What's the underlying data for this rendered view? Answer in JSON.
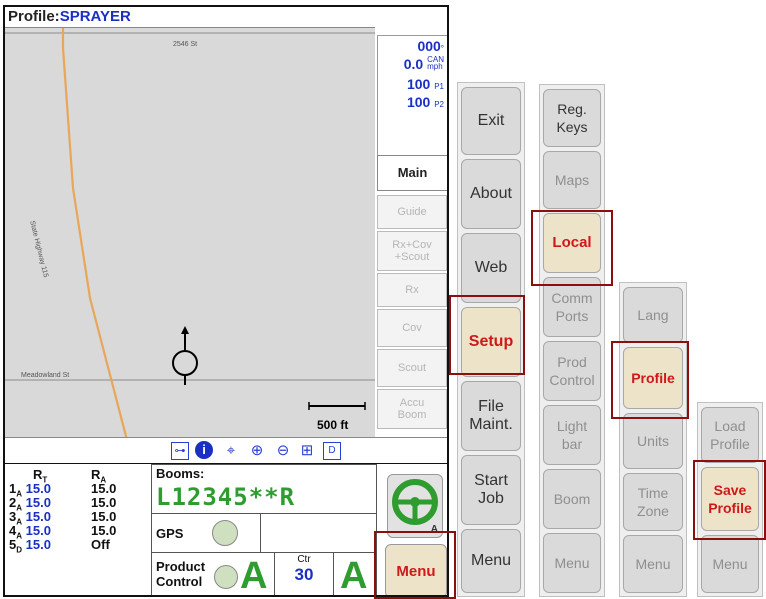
{
  "header": {
    "profile_label": "Profile:",
    "profile_name": "SPRAYER"
  },
  "map": {
    "road_top": "2546 St",
    "road_side": "State Highway 115",
    "road_bottom": "Meadowland St",
    "scale": "500 ft"
  },
  "status": {
    "heading": {
      "value": "000",
      "unit": "°"
    },
    "speed": {
      "value": "0.0",
      "unit_top": "CAN",
      "unit_bottom": "mph"
    },
    "p1": {
      "value": "100",
      "unit": "P1"
    },
    "p2": {
      "value": "100",
      "unit": "P2"
    }
  },
  "tabs": [
    {
      "label": "Main",
      "active": true
    },
    {
      "label": "Guide"
    },
    {
      "label": "Rx+Cov\n+Scout"
    },
    {
      "label": "Rx"
    },
    {
      "label": "Cov"
    },
    {
      "label": "Scout"
    },
    {
      "label": "Accu\nBoom"
    }
  ],
  "rates": {
    "rt_header": "R",
    "rt_sub": "T",
    "ra_header": "R",
    "ra_sub": "A",
    "rows": [
      {
        "idx": "1",
        "sub": "A",
        "rt": "15.0",
        "ra": "15.0"
      },
      {
        "idx": "2",
        "sub": "A",
        "rt": "15.0",
        "ra": "15.0"
      },
      {
        "idx": "3",
        "sub": "A",
        "rt": "15.0",
        "ra": "15.0"
      },
      {
        "idx": "4",
        "sub": "A",
        "rt": "15.0",
        "ra": "15.0"
      },
      {
        "idx": "5",
        "sub": "D",
        "rt": "15.0",
        "ra": "Off"
      }
    ]
  },
  "booms": {
    "label": "Booms:",
    "value": "L12345**R"
  },
  "gps": {
    "label": "GPS"
  },
  "product_control": {
    "label_line1": "Product",
    "label_line2": "Control",
    "mode1": "A",
    "ctr_label": "Ctr",
    "ctr_value": "30",
    "mode2": "A"
  },
  "steer": {
    "mode": "A"
  },
  "main_menu_label": "Menu",
  "menu_col1": [
    "Exit",
    "About",
    "Web",
    "Setup",
    "File\nMaint.",
    "Start\nJob",
    "Menu"
  ],
  "menu_col2": [
    "Reg.\nKeys",
    "Maps",
    "Local",
    "Comm\nPorts",
    "Prod\nControl",
    "Light\nbar",
    "Boom",
    "Menu"
  ],
  "menu_col3": [
    "Lang",
    "Profile",
    "Units",
    "Time\nZone",
    "Menu"
  ],
  "menu_col4": [
    "Load\nProfile",
    "Save\nProfile",
    "Menu"
  ],
  "colors": {
    "accent_blue": "#1a2fc4",
    "highlight_red": "#d01818",
    "boom_green": "#2e9c2e",
    "route_orange": "#e8a65a"
  }
}
